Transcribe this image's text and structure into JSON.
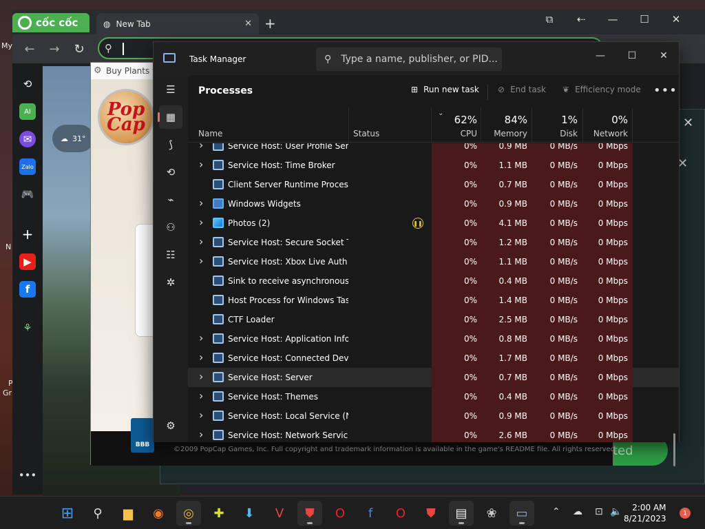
{
  "desktop": {
    "labels": [
      "My",
      "N",
      "P",
      "Gr"
    ]
  },
  "browser": {
    "coccoc_tab_label": "cốc cốc",
    "new_tab_label": "New Tab",
    "new_tab_close": "✕",
    "add_tab": "+",
    "weather_temp": "31°"
  },
  "popcap": {
    "window_title": "Buy Plants vs",
    "logo_text": "Pop Cap",
    "bbb_label": "BBB",
    "copyright": "©2009 PopCap Games, Inc. Full copyright and trademark information is available in the game's README file. All rights reserved.",
    "button_fragment": "ted"
  },
  "task_manager": {
    "title": "Task Manager",
    "search_placeholder": "Type a name, publisher, or PID...",
    "heading": "Processes",
    "toolbar": {
      "run_new_task": "Run new task",
      "end_task": "End task",
      "efficiency_mode": "Efficiency mode",
      "more": "•••"
    },
    "columns": {
      "name": "Name",
      "status": "Status",
      "cpu_pct": "62%",
      "cpu_label": "CPU",
      "memory_pct": "84%",
      "memory_label": "Memory",
      "disk_pct": "1%",
      "disk_label": "Disk",
      "network_pct": "0%",
      "network_label": "Network"
    },
    "rows": [
      {
        "name": "Service Host: User Profile Servi...",
        "expand": true,
        "icon": "service-icon",
        "cpu": "0%",
        "mem": "0.9 MB",
        "disk": "0 MB/s",
        "net": "0 Mbps"
      },
      {
        "name": "Service Host: Time Broker",
        "expand": true,
        "icon": "service-icon",
        "cpu": "0%",
        "mem": "1.1 MB",
        "disk": "0 MB/s",
        "net": "0 Mbps"
      },
      {
        "name": "Client Server Runtime Process",
        "expand": false,
        "icon": "process-icon",
        "cpu": "0%",
        "mem": "0.7 MB",
        "disk": "0 MB/s",
        "net": "0 Mbps"
      },
      {
        "name": "Windows Widgets",
        "expand": true,
        "icon": "widgets-icon",
        "cpu": "0%",
        "mem": "0.9 MB",
        "disk": "0 MB/s",
        "net": "0 Mbps"
      },
      {
        "name": "Photos (2)",
        "expand": true,
        "icon": "photos-icon",
        "paused": true,
        "cpu": "0%",
        "mem": "4.1 MB",
        "disk": "0 MB/s",
        "net": "0 Mbps"
      },
      {
        "name": "Service Host: Secure Socket Tu...",
        "expand": true,
        "icon": "service-icon",
        "cpu": "0%",
        "mem": "1.2 MB",
        "disk": "0 MB/s",
        "net": "0 Mbps"
      },
      {
        "name": "Service Host: Xbox Live Auth ...",
        "expand": true,
        "icon": "service-icon",
        "cpu": "0%",
        "mem": "1.1 MB",
        "disk": "0 MB/s",
        "net": "0 Mbps"
      },
      {
        "name": "Sink to receive asynchronous ...",
        "expand": false,
        "icon": "process-icon",
        "cpu": "0%",
        "mem": "0.4 MB",
        "disk": "0 MB/s",
        "net": "0 Mbps"
      },
      {
        "name": "Host Process for Windows Tasks",
        "expand": false,
        "icon": "process-icon",
        "cpu": "0%",
        "mem": "1.4 MB",
        "disk": "0 MB/s",
        "net": "0 Mbps"
      },
      {
        "name": "CTF Loader",
        "expand": false,
        "icon": "process-icon",
        "cpu": "0%",
        "mem": "2.5 MB",
        "disk": "0 MB/s",
        "net": "0 Mbps"
      },
      {
        "name": "Service Host: Application Infor...",
        "expand": true,
        "icon": "service-icon",
        "cpu": "0%",
        "mem": "0.8 MB",
        "disk": "0 MB/s",
        "net": "0 Mbps"
      },
      {
        "name": "Service Host: Connected Devi...",
        "expand": true,
        "icon": "service-icon",
        "cpu": "0%",
        "mem": "1.7 MB",
        "disk": "0 MB/s",
        "net": "0 Mbps"
      },
      {
        "name": "Service Host: Server",
        "expand": true,
        "icon": "service-icon",
        "highlight": true,
        "cpu": "0%",
        "mem": "0.7 MB",
        "disk": "0 MB/s",
        "net": "0 Mbps"
      },
      {
        "name": "Service Host: Themes",
        "expand": true,
        "icon": "service-icon",
        "cpu": "0%",
        "mem": "0.4 MB",
        "disk": "0 MB/s",
        "net": "0 Mbps"
      },
      {
        "name": "Service Host: Local Service (N...",
        "expand": true,
        "icon": "service-icon",
        "cpu": "0%",
        "mem": "0.9 MB",
        "disk": "0 MB/s",
        "net": "0 Mbps"
      },
      {
        "name": "Service Host: Network Service",
        "expand": true,
        "icon": "service-icon",
        "cpu": "0%",
        "mem": "2.6 MB",
        "disk": "0 MB/s",
        "net": "0 Mbps"
      }
    ]
  },
  "taskbar": {
    "time": "2:00 AM",
    "date": "8/21/2023",
    "notification_count": "1"
  },
  "colors": {
    "accent_green": "#4caf50",
    "metric_cell_bg": "#4a1a1a",
    "tm_bg": "#191919"
  }
}
